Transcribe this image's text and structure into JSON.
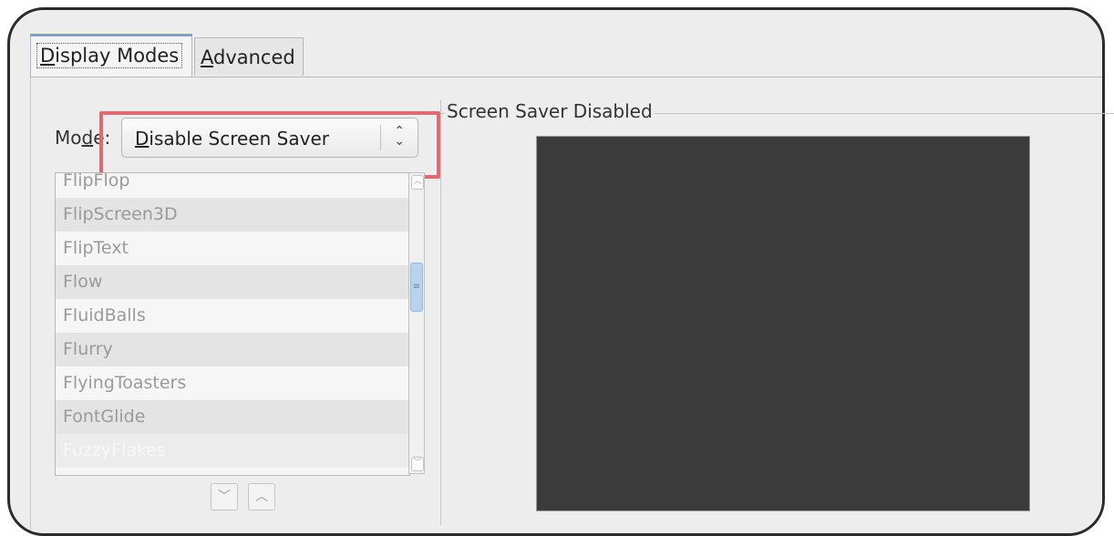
{
  "tabs": {
    "display_modes_mnemonic": "D",
    "display_modes_rest": "isplay Modes",
    "advanced_mnemonic": "A",
    "advanced_rest": "dvanced"
  },
  "mode": {
    "label_pre": "Mo",
    "label_mnemonic": "d",
    "label_post": "e:",
    "value_mnemonic": "D",
    "value_rest": "isable Screen Saver",
    "arrows": "⌃⌄"
  },
  "list": {
    "items": [
      "FlipFlop",
      "FlipScreen3D",
      "FlipText",
      "Flow",
      "FluidBalls",
      "Flurry",
      "FlyingToasters",
      "FontGlide",
      "FuzzyFlakes"
    ],
    "selected_index": 8
  },
  "scrollbar": {
    "up_icon": "up-arrow",
    "down_icon": "down-arrow",
    "thumb_glyph": "≡"
  },
  "move_buttons": {
    "down": "﹀",
    "up": "︿"
  },
  "preview": {
    "title": "Screen Saver Disabled",
    "color": "#3b3b3b"
  },
  "colors": {
    "highlight": "#e06a6f",
    "active_tab_accent": "#7fa1c9"
  }
}
